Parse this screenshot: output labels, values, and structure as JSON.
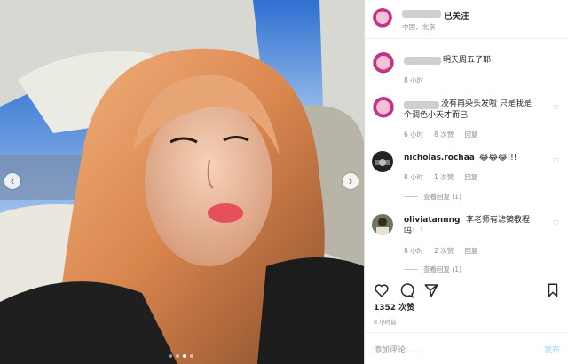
{
  "header": {
    "follow_status": "已关注",
    "location": "中国，北京"
  },
  "comments": [
    {
      "text": "明天周五了耶",
      "meta": [
        "8 小时"
      ]
    },
    {
      "text_line1": "没有再染头发啦 只是我是",
      "text_line2": "个调色小天才而已",
      "meta": [
        "6 小时",
        "8 次赞",
        "回复"
      ]
    },
    {
      "user": "nicholas.rochaa",
      "text": "😂😂😂!!!",
      "meta": [
        "8 小时",
        "1 次赞",
        "回复"
      ],
      "view_replies": "查看回复 (1)"
    },
    {
      "user": "oliviatannng",
      "text_line1": "李老师有滤镜教程",
      "text_line2": "吗！！",
      "meta": [
        "8 小时",
        "2 次赞",
        "回复"
      ],
      "view_replies": "查看回复 (1)"
    }
  ],
  "likes": "1352 次赞",
  "time_ago": "8 小时前",
  "add_comment": {
    "placeholder": "添加评论……",
    "post_label": "发布"
  },
  "icons": [
    "heart-icon",
    "comment-icon",
    "share-icon",
    "bookmark-icon",
    "chevron-left-icon",
    "chevron-right-icon"
  ],
  "colors": {
    "link_blue": "#b2dffc",
    "muted": "#8e8e8e",
    "avatar_ring": "#c13584"
  },
  "carousel": {
    "total": 4,
    "active": 3
  }
}
